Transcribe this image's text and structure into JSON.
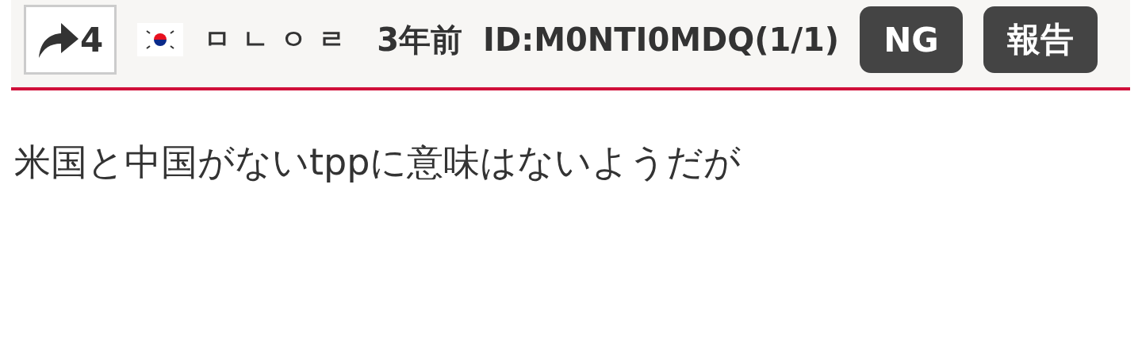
{
  "post": {
    "reply_count": "4",
    "name": "ㅁㄴㅇㄹ",
    "time": "3年前",
    "id": "ID:M0NTI0MDQ(1/1)",
    "buttons": [
      "NG",
      "報告"
    ],
    "body": "米国と中国がないtppに意味はないようだが"
  }
}
